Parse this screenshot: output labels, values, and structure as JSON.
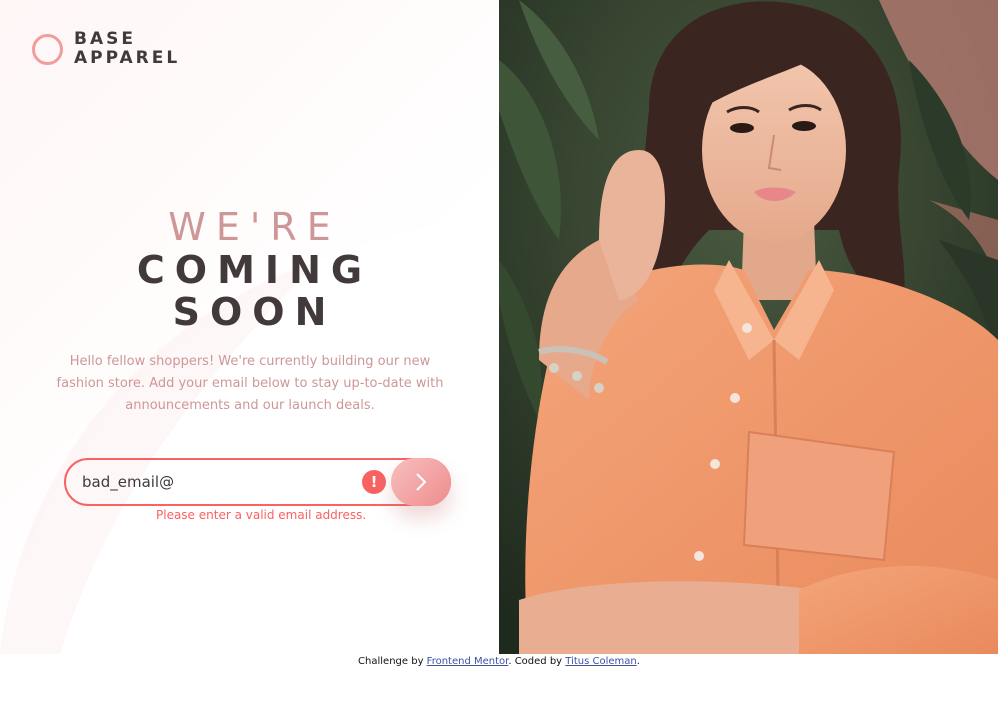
{
  "brand": {
    "line1": "BASE",
    "line2": "APPAREL"
  },
  "headline": {
    "light": "WE'RE",
    "bold1": "COMING",
    "bold2": "SOON"
  },
  "description": "Hello fellow shoppers! We're currently building our new fashion store. Add your email below to stay up-to-date with announcements and our launch deals.",
  "form": {
    "email_value": "bad_email@",
    "error_icon": "!",
    "error_message": "Please enter a valid email address."
  },
  "footer": {
    "prefix": "Challenge by ",
    "link1": "Frontend Mentor",
    "middle": ". Coded by ",
    "link2": "Titus Coleman",
    "suffix": "."
  },
  "colors": {
    "accent": "#ce9797",
    "dark": "#423a3a",
    "error": "#f96262",
    "gradient_start": "#f8bfbf",
    "gradient_end": "#ee8c8c",
    "shirt": "#f0966a"
  },
  "icons": {
    "logo": "ring-logo-icon",
    "submit": "arrow-right-icon",
    "error": "error-icon"
  }
}
